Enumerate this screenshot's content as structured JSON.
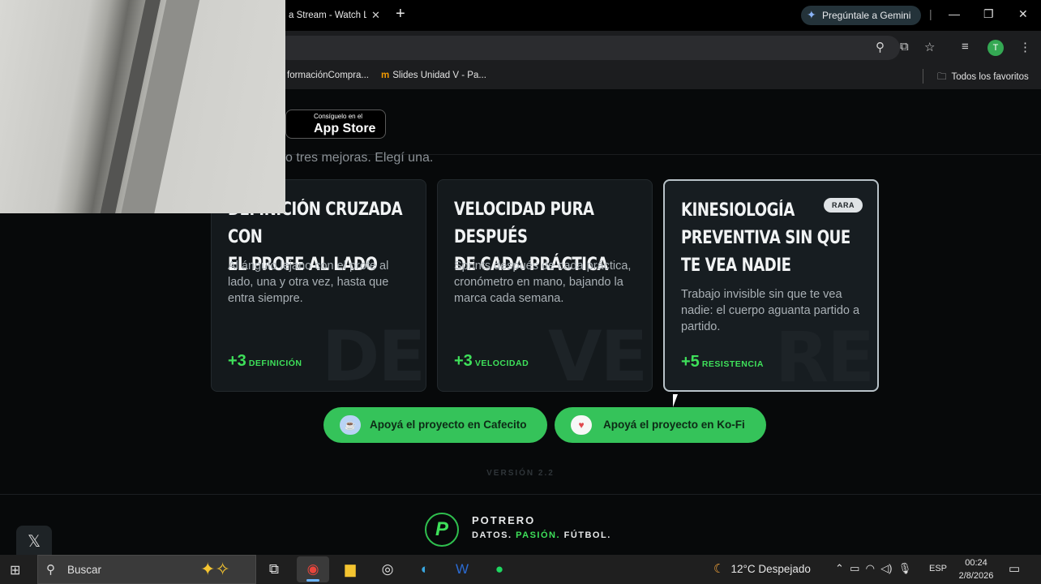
{
  "browser": {
    "tab_title": "a Stream - Watch Li",
    "tab_close": "✕",
    "new_tab": "+",
    "gemini_label": "Pregúntale a Gemini",
    "avatar_initial": "T",
    "bookmarks": [
      {
        "label": "formaciónCompra..."
      },
      {
        "label": "Slides Unidad V - Pa..."
      }
    ],
    "all_bookmarks": "Todos los favoritos"
  },
  "page": {
    "appstore_small": "Consíguelo en el",
    "appstore_large": "App Store",
    "intro": "o tres mejoras. Elegí una.",
    "cards": [
      {
        "title_lines": [
          "DEFINICIÓN CRUZADA CON",
          "EL PROFE AL LADO"
        ],
        "description": "Al ángulo lejano con el profe al lado, una y otra vez, hasta que entra siempre.",
        "stat_value": "+3",
        "stat_label": "DEFINICIÓN",
        "watermark": "DEF",
        "badge": ""
      },
      {
        "title_lines": [
          "VELOCIDAD PURA DESPUÉS",
          "DE CADA PRÁCTICA"
        ],
        "description": "Sprints después de cada práctica, cronómetro en mano, bajando la marca cada semana.",
        "stat_value": "+3",
        "stat_label": "VELOCIDAD",
        "watermark": "VEL",
        "badge": ""
      },
      {
        "title_lines": [
          "KINESIOLOGÍA",
          "PREVENTIVA SIN QUE",
          "TE VEA NADIE"
        ],
        "description": "Trabajo invisible sin que te vea nadie: el cuerpo aguanta partido a partido.",
        "stat_value": "+5",
        "stat_label": "RESISTENCIA",
        "watermark": "RES",
        "badge": "RARA"
      }
    ],
    "donate_cafecito": "Apoyá el proyecto en Cafecito",
    "donate_kofi": "Apoyá el proyecto en Ko-Fi",
    "version": "VERSIÓN 2.2",
    "brand": "POTRERO",
    "tagline_1": "DATOS.",
    "tagline_2": "PASIÓN.",
    "tagline_3": "FÚTBOL.",
    "x_button": "𝕏"
  },
  "taskbar": {
    "search": "Buscar",
    "weather": "12°C  Despejado",
    "lang": "ESP",
    "time": "00:24",
    "date": "2/8/2026"
  },
  "colors": {
    "accent_green": "#3ee05a",
    "button_green": "#35c35a",
    "card_bg": "#14191c"
  }
}
